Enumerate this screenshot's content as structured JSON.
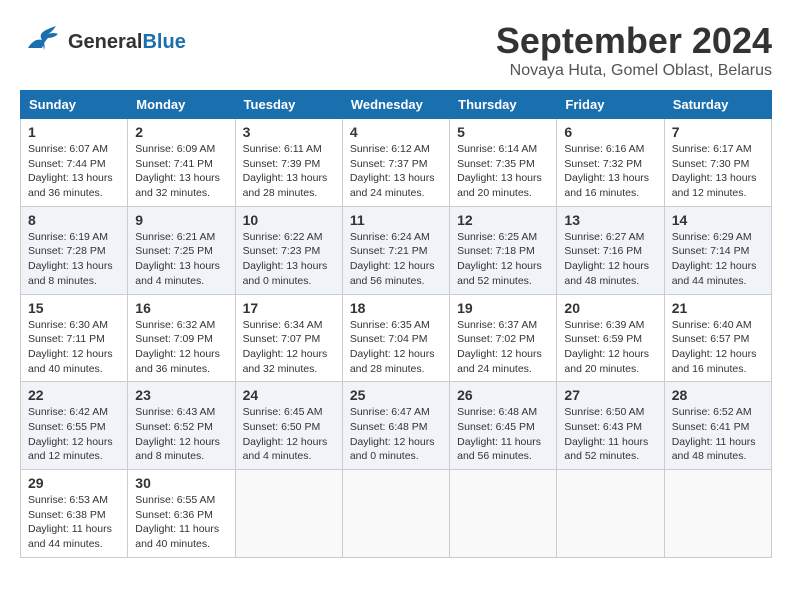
{
  "app": {
    "logo_line1": "General",
    "logo_line2": "Blue",
    "title": "September 2024",
    "subtitle": "Novaya Huta, Gomel Oblast, Belarus"
  },
  "calendar": {
    "headers": [
      "Sunday",
      "Monday",
      "Tuesday",
      "Wednesday",
      "Thursday",
      "Friday",
      "Saturday"
    ],
    "weeks": [
      [
        {
          "day": "",
          "info": ""
        },
        {
          "day": "2",
          "info": "Sunrise: 6:09 AM\nSunset: 7:41 PM\nDaylight: 13 hours\nand 32 minutes."
        },
        {
          "day": "3",
          "info": "Sunrise: 6:11 AM\nSunset: 7:39 PM\nDaylight: 13 hours\nand 28 minutes."
        },
        {
          "day": "4",
          "info": "Sunrise: 6:12 AM\nSunset: 7:37 PM\nDaylight: 13 hours\nand 24 minutes."
        },
        {
          "day": "5",
          "info": "Sunrise: 6:14 AM\nSunset: 7:35 PM\nDaylight: 13 hours\nand 20 minutes."
        },
        {
          "day": "6",
          "info": "Sunrise: 6:16 AM\nSunset: 7:32 PM\nDaylight: 13 hours\nand 16 minutes."
        },
        {
          "day": "7",
          "info": "Sunrise: 6:17 AM\nSunset: 7:30 PM\nDaylight: 13 hours\nand 12 minutes."
        }
      ],
      [
        {
          "day": "8",
          "info": "Sunrise: 6:19 AM\nSunset: 7:28 PM\nDaylight: 13 hours\nand 8 minutes."
        },
        {
          "day": "9",
          "info": "Sunrise: 6:21 AM\nSunset: 7:25 PM\nDaylight: 13 hours\nand 4 minutes."
        },
        {
          "day": "10",
          "info": "Sunrise: 6:22 AM\nSunset: 7:23 PM\nDaylight: 13 hours\nand 0 minutes."
        },
        {
          "day": "11",
          "info": "Sunrise: 6:24 AM\nSunset: 7:21 PM\nDaylight: 12 hours\nand 56 minutes."
        },
        {
          "day": "12",
          "info": "Sunrise: 6:25 AM\nSunset: 7:18 PM\nDaylight: 12 hours\nand 52 minutes."
        },
        {
          "day": "13",
          "info": "Sunrise: 6:27 AM\nSunset: 7:16 PM\nDaylight: 12 hours\nand 48 minutes."
        },
        {
          "day": "14",
          "info": "Sunrise: 6:29 AM\nSunset: 7:14 PM\nDaylight: 12 hours\nand 44 minutes."
        }
      ],
      [
        {
          "day": "15",
          "info": "Sunrise: 6:30 AM\nSunset: 7:11 PM\nDaylight: 12 hours\nand 40 minutes."
        },
        {
          "day": "16",
          "info": "Sunrise: 6:32 AM\nSunset: 7:09 PM\nDaylight: 12 hours\nand 36 minutes."
        },
        {
          "day": "17",
          "info": "Sunrise: 6:34 AM\nSunset: 7:07 PM\nDaylight: 12 hours\nand 32 minutes."
        },
        {
          "day": "18",
          "info": "Sunrise: 6:35 AM\nSunset: 7:04 PM\nDaylight: 12 hours\nand 28 minutes."
        },
        {
          "day": "19",
          "info": "Sunrise: 6:37 AM\nSunset: 7:02 PM\nDaylight: 12 hours\nand 24 minutes."
        },
        {
          "day": "20",
          "info": "Sunrise: 6:39 AM\nSunset: 6:59 PM\nDaylight: 12 hours\nand 20 minutes."
        },
        {
          "day": "21",
          "info": "Sunrise: 6:40 AM\nSunset: 6:57 PM\nDaylight: 12 hours\nand 16 minutes."
        }
      ],
      [
        {
          "day": "22",
          "info": "Sunrise: 6:42 AM\nSunset: 6:55 PM\nDaylight: 12 hours\nand 12 minutes."
        },
        {
          "day": "23",
          "info": "Sunrise: 6:43 AM\nSunset: 6:52 PM\nDaylight: 12 hours\nand 8 minutes."
        },
        {
          "day": "24",
          "info": "Sunrise: 6:45 AM\nSunset: 6:50 PM\nDaylight: 12 hours\nand 4 minutes."
        },
        {
          "day": "25",
          "info": "Sunrise: 6:47 AM\nSunset: 6:48 PM\nDaylight: 12 hours\nand 0 minutes."
        },
        {
          "day": "26",
          "info": "Sunrise: 6:48 AM\nSunset: 6:45 PM\nDaylight: 11 hours\nand 56 minutes."
        },
        {
          "day": "27",
          "info": "Sunrise: 6:50 AM\nSunset: 6:43 PM\nDaylight: 11 hours\nand 52 minutes."
        },
        {
          "day": "28",
          "info": "Sunrise: 6:52 AM\nSunset: 6:41 PM\nDaylight: 11 hours\nand 48 minutes."
        }
      ],
      [
        {
          "day": "29",
          "info": "Sunrise: 6:53 AM\nSunset: 6:38 PM\nDaylight: 11 hours\nand 44 minutes."
        },
        {
          "day": "30",
          "info": "Sunrise: 6:55 AM\nSunset: 6:36 PM\nDaylight: 11 hours\nand 40 minutes."
        },
        {
          "day": "",
          "info": ""
        },
        {
          "day": "",
          "info": ""
        },
        {
          "day": "",
          "info": ""
        },
        {
          "day": "",
          "info": ""
        },
        {
          "day": "",
          "info": ""
        }
      ]
    ]
  },
  "week1_sunday": {
    "day": "1",
    "info": "Sunrise: 6:07 AM\nSunset: 7:44 PM\nDaylight: 13 hours\nand 36 minutes."
  }
}
